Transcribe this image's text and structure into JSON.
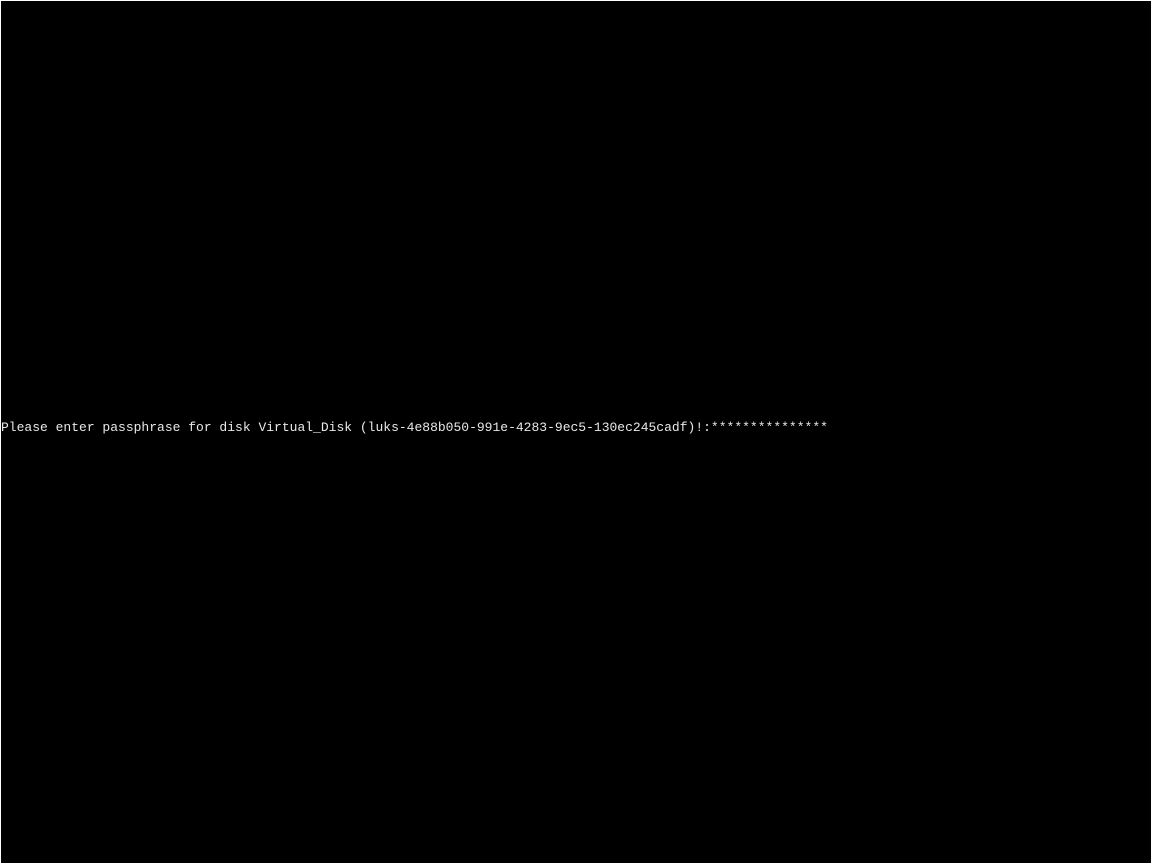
{
  "console": {
    "prompt": "Please enter passphrase for disk Virtual_Disk (luks-4e88b050-991e-4283-9ec5-130ec245cadf)!:",
    "passphrase_mask": "***************"
  }
}
